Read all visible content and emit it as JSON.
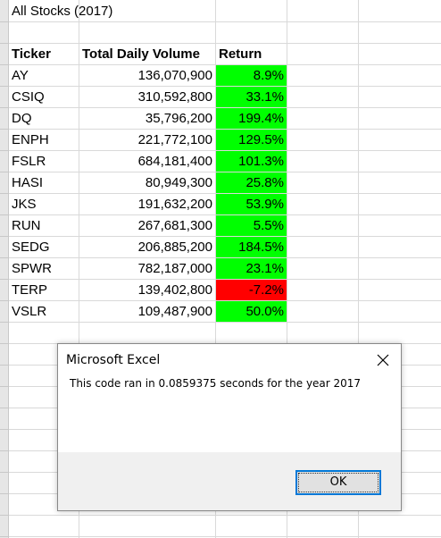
{
  "sheet": {
    "title": "All Stocks (2017)",
    "headers": {
      "ticker": "Ticker",
      "volume": "Total Daily Volume",
      "return": "Return"
    },
    "rows": [
      {
        "ticker": "AY",
        "volume": "136,070,900",
        "return": "8.9%",
        "positive": true
      },
      {
        "ticker": "CSIQ",
        "volume": "310,592,800",
        "return": "33.1%",
        "positive": true
      },
      {
        "ticker": "DQ",
        "volume": "35,796,200",
        "return": "199.4%",
        "positive": true
      },
      {
        "ticker": "ENPH",
        "volume": "221,772,100",
        "return": "129.5%",
        "positive": true
      },
      {
        "ticker": "FSLR",
        "volume": "684,181,400",
        "return": "101.3%",
        "positive": true
      },
      {
        "ticker": "HASI",
        "volume": "80,949,300",
        "return": "25.8%",
        "positive": true
      },
      {
        "ticker": "JKS",
        "volume": "191,632,200",
        "return": "53.9%",
        "positive": true
      },
      {
        "ticker": "RUN",
        "volume": "267,681,300",
        "return": "5.5%",
        "positive": true
      },
      {
        "ticker": "SEDG",
        "volume": "206,885,200",
        "return": "184.5%",
        "positive": true
      },
      {
        "ticker": "SPWR",
        "volume": "782,187,000",
        "return": "23.1%",
        "positive": true
      },
      {
        "ticker": "TERP",
        "volume": "139,402,800",
        "return": "-7.2%",
        "positive": false
      },
      {
        "ticker": "VSLR",
        "volume": "109,487,900",
        "return": "50.0%",
        "positive": true
      }
    ],
    "colors": {
      "positive": "#00ff00",
      "negative": "#ff0000",
      "gridline": "#d9d9d9"
    }
  },
  "dialog": {
    "title": "Microsoft Excel",
    "message": "This code ran in 0.0859375 seconds for the year 2017",
    "ok_label": "OK",
    "close_icon": "close-icon",
    "accent": "#0078d7"
  }
}
